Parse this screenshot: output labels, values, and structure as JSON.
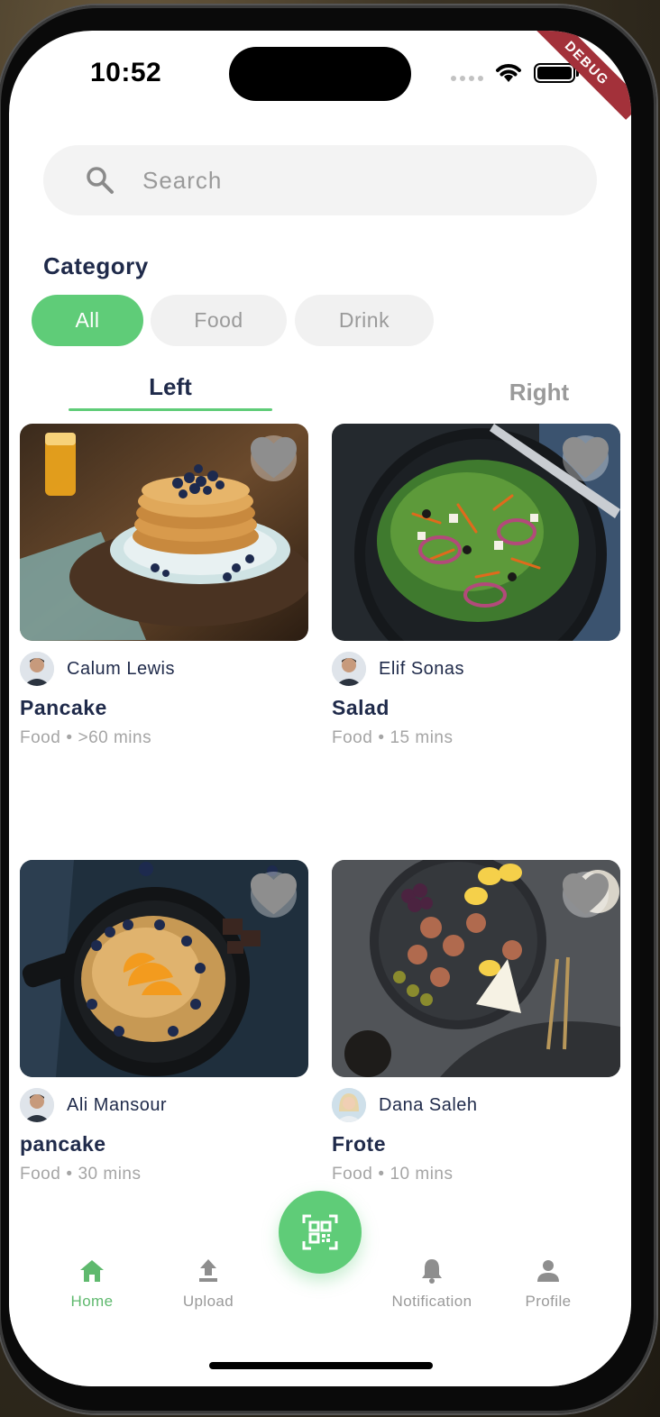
{
  "status_bar": {
    "time": "10:52",
    "debug_label": "DEBUG"
  },
  "search": {
    "placeholder": "Search"
  },
  "category": {
    "title": "Category",
    "chips": [
      {
        "label": "All",
        "active": true
      },
      {
        "label": "Food",
        "active": false
      },
      {
        "label": "Drink",
        "active": false
      }
    ]
  },
  "tabs": {
    "left": "Left",
    "right": "Right",
    "selected": "left"
  },
  "recipes": [
    {
      "author": "Calum Lewis",
      "title": "Pancake",
      "category": "Food",
      "dot": "•",
      "duration": ">60 mins",
      "photo_icon": "pancake-stack-photo"
    },
    {
      "author": "Elif Sonas",
      "title": "Salad",
      "category": "Food",
      "dot": "•",
      "duration": "15 mins",
      "photo_icon": "salad-bowl-photo"
    },
    {
      "author": "Ali Mansour",
      "title": "pancake",
      "category": "Food",
      "dot": "•",
      "duration": "30 mins",
      "photo_icon": "skillet-pancake-photo"
    },
    {
      "author": "Dana Saleh",
      "title": "Frote",
      "category": "Food",
      "dot": "•",
      "duration": "10 mins",
      "photo_icon": "platter-photo"
    }
  ],
  "bottom_nav": {
    "items": [
      {
        "label": "Home",
        "icon": "home-icon",
        "active": true
      },
      {
        "label": "Upload",
        "icon": "upload-icon",
        "active": false
      },
      {
        "label": "Notification",
        "icon": "bell-icon",
        "active": false
      },
      {
        "label": "Profile",
        "icon": "person-icon",
        "active": false
      }
    ],
    "fab_icon": "qr-scan-icon"
  },
  "colors": {
    "accent": "#5fcc78",
    "title_text": "#1f2a4a",
    "muted_text": "#9a9a9a",
    "debug_ribbon": "#a3313a"
  }
}
